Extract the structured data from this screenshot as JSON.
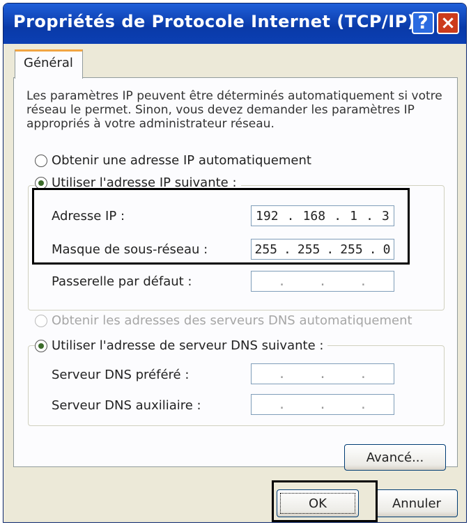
{
  "window": {
    "title": "Propriétés de Protocole Internet (TCP/IP)",
    "help_glyph": "?",
    "close_glyph": "×"
  },
  "tabs": [
    {
      "label": "Général"
    }
  ],
  "description": {
    "line1": "Les paramètres IP peuvent être déterminés automatiquement si votre",
    "line2": "réseau le permet. Sinon, vous devez demander les paramètres IP",
    "line3": "appropriés à votre administrateur réseau."
  },
  "ip_mode": {
    "auto_label": "Obtenir une adresse IP automatiquement",
    "manual_label": "Utiliser l'adresse IP suivante :",
    "selected": "manual"
  },
  "ip_fields": {
    "address": {
      "label": "Adresse IP :",
      "octets": [
        "192",
        "168",
        "1",
        "3"
      ]
    },
    "subnet": {
      "label": "Masque de sous-réseau :",
      "octets": [
        "255",
        "255",
        "255",
        "0"
      ]
    },
    "gateway": {
      "label": "Passerelle par défaut :",
      "octets": [
        "",
        "",
        "",
        ""
      ]
    }
  },
  "dns_mode": {
    "auto_label": "Obtenir les adresses des serveurs DNS automatiquement",
    "manual_label": "Utiliser l'adresse de serveur DNS suivante :",
    "selected": "manual"
  },
  "dns_fields": {
    "preferred": {
      "label": "Serveur DNS préféré :",
      "octets": [
        "",
        "",
        "",
        ""
      ]
    },
    "alternate": {
      "label": "Serveur DNS auxiliaire :",
      "octets": [
        "",
        "",
        "",
        ""
      ]
    }
  },
  "buttons": {
    "advanced": "Avancé...",
    "ok": "OK",
    "cancel": "Annuler"
  },
  "colors": {
    "titlebar": "#0a3aa8",
    "dialog_bg": "#ece9d8",
    "tab_accent": "#f1a542"
  }
}
